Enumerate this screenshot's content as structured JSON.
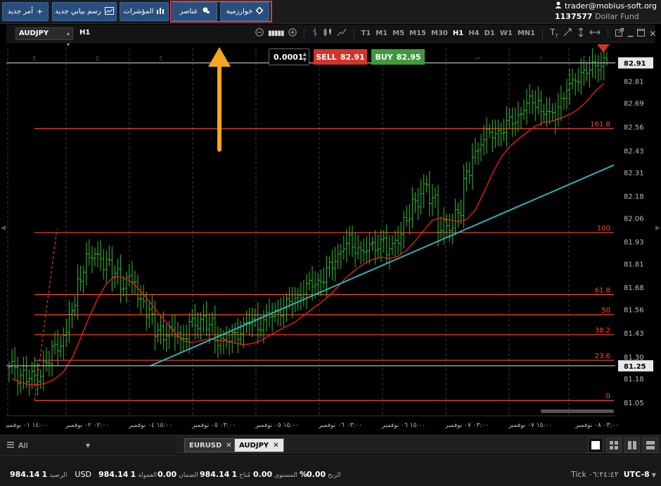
{
  "toolbar": {
    "new_order": "أمر جديد",
    "new_chart": "رسم بياني جديد",
    "indicators": "المؤشرات",
    "elements": "عناصر",
    "algorithmic": "خوارزمية"
  },
  "account": {
    "email": "trader@mobius-soft.org",
    "number": "1137577",
    "fund": "Dollar Fund"
  },
  "chart": {
    "symbol": "AUDJPY",
    "timeframe": "H1",
    "timeframes": [
      "T1",
      "M1",
      "M5",
      "M15",
      "M30",
      "H1",
      "H4",
      "D1",
      "W1",
      "MN1"
    ],
    "active_timeframe": "H1",
    "quantity": "0.0001",
    "sell_label": "SELL",
    "sell_price": "82.91",
    "buy_label": "BUY",
    "buy_price": "82.95",
    "current_price_tag": "82.91",
    "crosshair_price_tag": "81.25",
    "fib_labels": [
      "161.8",
      "100",
      "61.8",
      "50",
      "38.2",
      "23.6",
      "0"
    ],
    "day_marks": [
      "ج",
      "ج",
      "ج",
      "ج",
      "د",
      "د",
      "د",
      "ب",
      "د",
      "ج"
    ],
    "x_labels": [
      "١٤:٠٠ ٠١ نوفمبر",
      "٠٢:٠٠ ٠٢ نوفمبر",
      "١٥:٠٠ ٠٤ نوفمبر",
      "٠٣:٠٠ ٠٥ نوفمبر",
      "١٥:٠٠ ٠٥ نوفمبر",
      "٠٣:٠٠ ٠٦ نوفمبر",
      "١٥:٠٠ ٠٦ نوفمبر",
      "٠٣:٠٠ ٠٧ نوفمبر",
      "١٥:٠٠ ٠٧ نوفمبر",
      "٠٣:٠٠ ٠٨ نوفمبر"
    ],
    "colors": {
      "up_bar": "#2fbf2f",
      "fib_line": "#ff4b1f",
      "ma_line": "#ff1a1a",
      "trend_line": "#2bb3b8",
      "price_line": "#dcdcdc",
      "sell": "#d2342a",
      "buy": "#3f9a3b"
    }
  },
  "chart_data": {
    "type": "line",
    "title": "",
    "ylim": [
      80.98,
      83.02
    ],
    "y_ticks": [
      82.81,
      82.69,
      82.56,
      82.43,
      82.31,
      82.18,
      82.06,
      81.93,
      81.81,
      81.68,
      81.56,
      81.43,
      81.3,
      81.18,
      81.05
    ],
    "fib_levels": [
      {
        "label": "161.8",
        "price": 82.55
      },
      {
        "label": "100",
        "price": 81.98
      },
      {
        "label": "61.8",
        "price": 81.64
      },
      {
        "label": "50",
        "price": 81.53
      },
      {
        "label": "38.2",
        "price": 81.42
      },
      {
        "label": "23.6",
        "price": 81.28
      },
      {
        "label": "0",
        "price": 81.06
      }
    ],
    "series": [
      {
        "values": [
          81.24,
          81.2,
          81.18,
          81.2,
          81.26,
          81.35,
          81.4,
          81.55,
          81.75,
          81.84,
          81.86,
          81.8,
          81.76,
          81.7,
          81.72,
          81.62,
          81.52,
          81.45,
          81.42,
          81.44,
          81.4,
          81.48,
          81.5,
          81.47,
          81.4,
          81.38,
          81.42,
          81.46,
          81.5,
          81.48,
          81.52,
          81.55,
          81.58,
          81.62,
          81.66,
          81.7,
          81.72,
          81.78,
          81.86,
          81.92,
          81.9,
          81.88,
          81.9,
          81.93,
          81.88,
          81.96,
          82.05,
          82.15,
          82.22,
          82.16,
          82.02,
          82.0,
          82.1,
          82.28,
          82.42,
          82.5,
          82.52,
          82.54,
          82.58,
          82.62,
          82.68,
          82.7,
          82.64,
          82.62,
          82.7,
          82.78,
          82.84,
          82.86,
          82.9,
          82.91
        ]
      }
    ]
  },
  "tabs": {
    "filter": "All",
    "items": [
      "EURUSD",
      "AUDJPY"
    ],
    "active": "AUDJPY"
  },
  "status": {
    "balance_value": "984.14",
    "balance_label": "الرصيد",
    "currency": "USD",
    "equity_value": "984.14",
    "equity_label": "العمولة",
    "margin_value": "0.00",
    "margin_label": "الضمان",
    "free_value": "984.14",
    "free_label": "مُتاح",
    "level_value": "0.00",
    "level_label": "المستوى",
    "level_unit": "%",
    "profit_value": "0.00",
    "profit_label": "الربح",
    "tick_label": "Tick",
    "time": "٠٦:٢٤:٤٢",
    "timezone": "UTC-8",
    "balance_prefix": "1",
    "equity_prefix": "1",
    "free_prefix": "1"
  }
}
